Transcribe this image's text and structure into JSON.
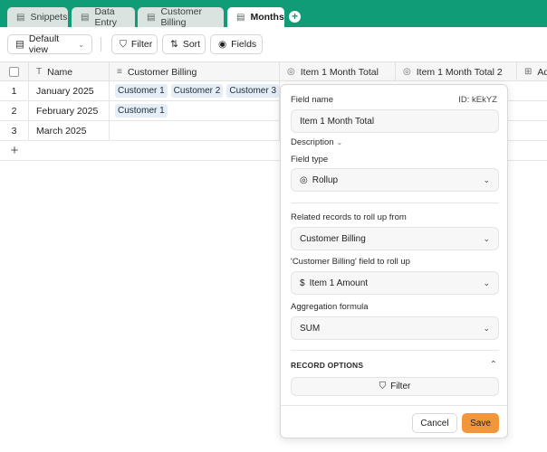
{
  "tabs": [
    {
      "label": "Snippets",
      "icon": "table-icon"
    },
    {
      "label": "Data Entry",
      "icon": "table-icon"
    },
    {
      "label": "Customer Billing",
      "icon": "table-icon"
    },
    {
      "label": "Months",
      "icon": "table-icon",
      "active": true
    }
  ],
  "toolbar": {
    "view_label": "Default view",
    "filter_label": "Filter",
    "sort_label": "Sort",
    "fields_label": "Fields"
  },
  "columns": {
    "name": "Name",
    "customer_billing": "Customer Billing",
    "item_total": "Item 1 Month Total",
    "item_total_2": "Item 1 Month Total 2",
    "add_partial": "Ad"
  },
  "rows": [
    {
      "num": "1",
      "name": "January 2025",
      "customers": [
        "Customer 1",
        "Customer 2",
        "Customer 3"
      ]
    },
    {
      "num": "2",
      "name": "February 2025",
      "customers": [
        "Customer 1"
      ]
    },
    {
      "num": "3",
      "name": "March 2025",
      "customers": []
    }
  ],
  "panel": {
    "field_name_label": "Field name",
    "field_id": "ID: kEkYZ",
    "field_name_value": "Item 1 Month Total",
    "description_label": "Description",
    "field_type_label": "Field type",
    "field_type_value": "Rollup",
    "related_label": "Related records to roll up from",
    "related_value": "Customer Billing",
    "rollup_field_label": "'Customer Billing' field to roll up",
    "rollup_field_value": "Item 1 Amount",
    "aggregation_label": "Aggregation formula",
    "aggregation_value": "SUM",
    "record_options_label": "RECORD OPTIONS",
    "filter_label": "Filter",
    "cancel_label": "Cancel",
    "save_label": "Save"
  },
  "colors": {
    "brand_green": "#0f9c76",
    "save_orange": "#f2963a",
    "chip_blue": "#e5edf7"
  }
}
